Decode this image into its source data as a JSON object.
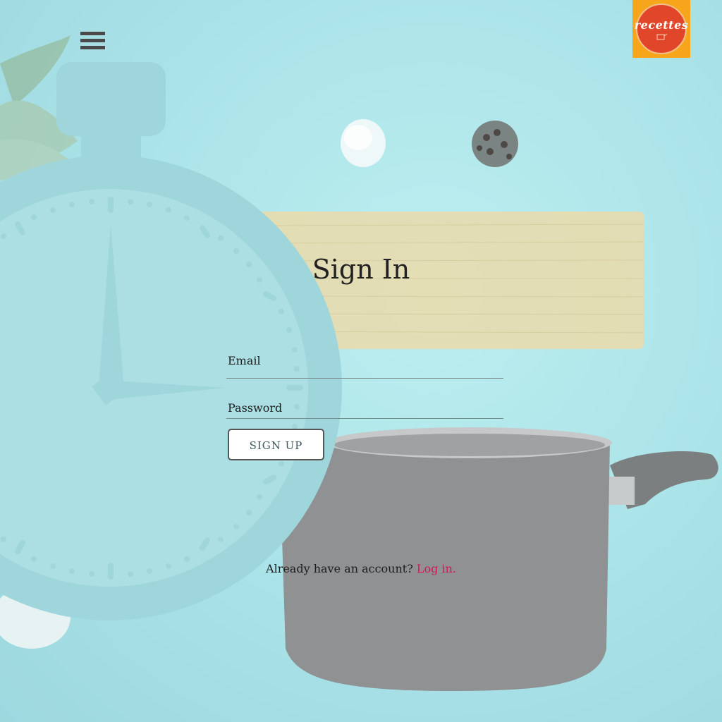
{
  "header": {
    "menu_icon": "hamburger-menu-icon",
    "logo_text": "recettes",
    "logo_colors": {
      "background": "#f7a51b",
      "circle": "#e2462a"
    }
  },
  "form": {
    "title": "Sign In",
    "email_label": "Email",
    "email_value": "",
    "password_label": "Password",
    "password_value": "",
    "submit_label": "SIGN UP"
  },
  "footer": {
    "prompt": "Already have an account?",
    "login_link": "Log in.",
    "link_color": "#d2145a"
  },
  "background": {
    "description_icons": [
      "stopwatch-icon",
      "cooking-pot-image",
      "spaghetti-image",
      "salt-image",
      "peppercorn-image",
      "bay-leaf-image",
      "garlic-image"
    ]
  }
}
